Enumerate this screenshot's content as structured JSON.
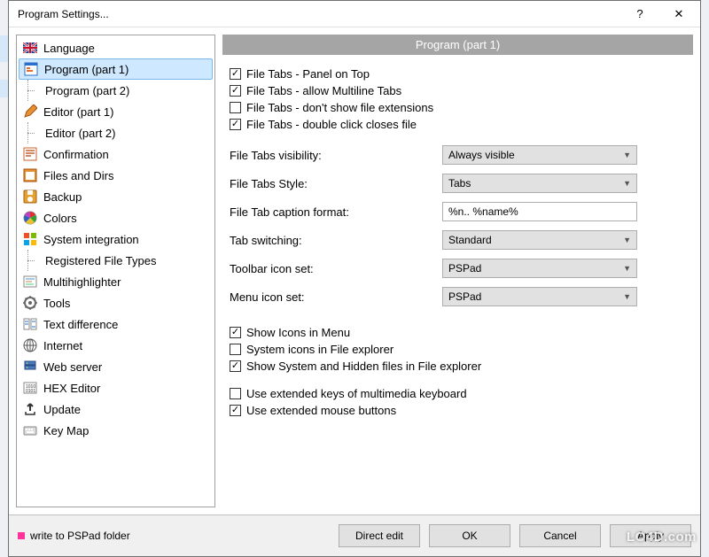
{
  "window": {
    "title": "Program Settings...",
    "help": "?",
    "close": "✕"
  },
  "sidebar": {
    "items": [
      {
        "label": "Language",
        "icon": "flag-uk-icon"
      },
      {
        "label": "Program  (part 1)",
        "icon": "program-icon",
        "selected": true
      },
      {
        "label": "Program  (part 2)",
        "icon": "none",
        "child": true
      },
      {
        "label": "Editor  (part 1)",
        "icon": "editor-icon"
      },
      {
        "label": "Editor  (part 2)",
        "icon": "none",
        "child": true
      },
      {
        "label": "Confirmation",
        "icon": "confirm-icon"
      },
      {
        "label": "Files and Dirs",
        "icon": "files-icon"
      },
      {
        "label": "Backup",
        "icon": "backup-icon"
      },
      {
        "label": "Colors",
        "icon": "colors-icon"
      },
      {
        "label": "System integration",
        "icon": "windows-icon"
      },
      {
        "label": "Registered File Types",
        "icon": "none",
        "child": true
      },
      {
        "label": "Multihighlighter",
        "icon": "highlight-icon"
      },
      {
        "label": "Tools",
        "icon": "tools-icon"
      },
      {
        "label": "Text difference",
        "icon": "diff-icon"
      },
      {
        "label": "Internet",
        "icon": "globe-icon"
      },
      {
        "label": "Web server",
        "icon": "server-icon"
      },
      {
        "label": "HEX Editor",
        "icon": "hex-icon"
      },
      {
        "label": "Update",
        "icon": "update-icon"
      },
      {
        "label": "Key Map",
        "icon": "keymap-icon"
      }
    ]
  },
  "main": {
    "heading": "Program  (part 1)",
    "cb_group1": [
      {
        "label": "File Tabs - Panel on Top",
        "checked": true
      },
      {
        "label": "File Tabs - allow Multiline Tabs",
        "checked": true
      },
      {
        "label": "File Tabs - don't show file extensions",
        "checked": false
      },
      {
        "label": "File Tabs - double click closes file",
        "checked": true
      }
    ],
    "fields": [
      {
        "label": "File Tabs visibility:",
        "type": "select",
        "value": "Always visible"
      },
      {
        "label": "File Tabs Style:",
        "type": "select",
        "value": "Tabs"
      },
      {
        "label": "File Tab caption format:",
        "type": "text",
        "value": "%n.. %name%"
      },
      {
        "label": "Tab switching:",
        "type": "select",
        "value": "Standard"
      },
      {
        "label": "Toolbar icon set:",
        "type": "select",
        "value": "PSPad"
      },
      {
        "label": "Menu icon set:",
        "type": "select",
        "value": "PSPad"
      }
    ],
    "cb_group2": [
      {
        "label": "Show Icons in Menu",
        "checked": true
      },
      {
        "label": "System icons in File explorer",
        "checked": false
      },
      {
        "label": "Show System and Hidden files in File explorer",
        "checked": true
      }
    ],
    "cb_group3": [
      {
        "label": "Use extended keys of multimedia keyboard",
        "checked": false
      },
      {
        "label": "Use extended mouse buttons",
        "checked": true
      }
    ]
  },
  "footer": {
    "status": "write to PSPad folder",
    "buttons": {
      "direct_edit": "Direct edit",
      "ok": "OK",
      "cancel": "Cancel",
      "apply": "Apply"
    }
  },
  "watermark": "LO4D.com",
  "icons": {
    "flag-uk-icon": "<svg width='16' height='12'><rect width='16' height='12' fill='#1a3c8a'/><path d='M0 0 L16 12 M16 0 L0 12' stroke='#fff' stroke-width='2.5'/><path d='M0 0 L16 12 M16 0 L0 12' stroke='#c8102e' stroke-width='1'/><rect x='6.5' width='3' height='12' fill='#fff'/><rect y='4.5' width='16' height='3' fill='#fff'/><rect x='7' width='2' height='12' fill='#c8102e'/><rect y='5' width='16' height='2' fill='#c8102e'/></svg>",
    "program-icon": "<svg width='16' height='16'><rect x='1' y='1' width='14' height='14' fill='#fff' stroke='#2a6fc9'/><rect x='1' y='1' width='14' height='3' fill='#2a6fc9'/><rect x='3' y='6' width='4' height='2' fill='#e07030'/><rect x='3' y='9' width='7' height='2' fill='#e07030'/></svg>",
    "editor-icon": "<svg width='16' height='16'><path d='M2 14 L4 8 L12 0 L16 4 L8 12 Z' fill='#e89030' stroke='#a05010'/><path d='M2 14 L1 15 L2 14' fill='#333'/></svg>",
    "confirm-icon": "<svg width='16' height='16'><rect x='1' y='1' width='14' height='14' fill='#fff' stroke='#c86030'/><path d='M3 4 h10 M3 7 h10 M3 10 h6' stroke='#c86030' stroke-width='1.5'/></svg>",
    "files-icon": "<svg width='16' height='16'><rect x='1' y='1' width='14' height='14' fill='#e89030' stroke='#a05010'/><rect x='3' y='4' width='10' height='9' fill='#fff'/></svg>",
    "backup-icon": "<svg width='16' height='16'><rect x='1' y='1' width='14' height='14' fill='#e8a030' stroke='#a06010' rx='1'/><rect x='5' y='1' width='6' height='5' fill='#fff'/><circle cx='8' cy='11' r='3' fill='#fff'/></svg>",
    "colors-icon": "<svg width='16' height='16'><circle cx='8' cy='8' r='7' fill='#fff' stroke='#888'/><path d='M8 8 L8 1 A7 7 0 0 1 14 5 Z' fill='#e03030'/><path d='M8 8 L14 5 A7 7 0 0 1 13 13 Z' fill='#30a030'/><path d='M8 8 L13 13 A7 7 0 0 1 3 13 Z' fill='#e8c030'/><path d='M8 8 L3 13 A7 7 0 0 1 2 5 Z' fill='#3060c0'/><path d='M8 8 L2 5 A7 7 0 0 1 8 1 Z' fill='#c040c0'/></svg>",
    "windows-icon": "<svg width='16' height='16'><rect x='1' y='1' width='6' height='6' fill='#f25022'/><rect x='9' y='1' width='6' height='6' fill='#7fba00'/><rect x='1' y='9' width='6' height='6' fill='#00a4ef'/><rect x='9' y='9' width='6' height='6' fill='#ffb900'/></svg>",
    "highlight-icon": "<svg width='16' height='16'><rect x='1' y='2' width='14' height='12' fill='#fff' stroke='#888'/><rect x='3' y='4' width='10' height='2' fill='#a0c8e8'/><rect x='3' y='7' width='7' height='2' fill='#e8c0a0'/><rect x='3' y='10' width='9' height='2' fill='#a0e8c0'/></svg>",
    "tools-icon": "<svg width='16' height='16'><circle cx='8' cy='8' r='6' fill='none' stroke='#666' stroke-width='2'/><circle cx='8' cy='8' r='2' fill='#666'/><path d='M8 0v3M8 13v3M0 8h3M13 8h3M2.5 2.5l2 2M11.5 11.5l2 2M2.5 13.5l2-2M11.5 4.5l2-2' stroke='#666' stroke-width='1.5'/></svg>",
    "diff-icon": "<svg width='16' height='16'><rect x='1' y='2' width='6' height='12' fill='#fff' stroke='#888'/><rect x='9' y='2' width='6' height='12' fill='#fff' stroke='#888'/><path d='M2 5h4M2 8h4M10 5h4M10 11h4' stroke='#2a6fc9'/></svg>",
    "globe-icon": "<svg width='16' height='16'><circle cx='8' cy='8' r='7' fill='#fff' stroke='#555'/><path d='M1 8h14M8 1v14' stroke='#555'/><ellipse cx='8' cy='8' rx='3.5' ry='7' fill='none' stroke='#555'/></svg>",
    "server-icon": "<svg width='16' height='16'><rect x='2' y='2' width='12' height='4' fill='#4a7ac0' stroke='#2a4a80'/><rect x='2' y='7' width='12' height='4' fill='#4a7ac0' stroke='#2a4a80'/><circle cx='4.5' cy='4' r='0.8' fill='#9f6'/><circle cx='4.5' cy='9' r='0.8' fill='#9f6'/></svg>",
    "hex-icon": "<svg width='16' height='16'><rect x='1' y='2' width='14' height='12' fill='#fff' stroke='#888'/><text x='3' y='8' font-size='5' fill='#333'>1010</text><text x='3' y='13' font-size='5' fill='#333'>0101</text></svg>",
    "update-icon": "<svg width='16' height='16'><path d='M8 2 L8 10 M8 2 L5 5 M8 2 L11 5' stroke='#333' stroke-width='2' fill='none'/><path d='M3 11 v3 h10 v-3' stroke='#333' stroke-width='1.5' fill='none'/></svg>",
    "keymap-icon": "<svg width='16' height='16'><rect x='1' y='4' width='14' height='9' fill='#ddd' stroke='#888' rx='1'/><rect x='3' y='6' width='2' height='2' fill='#fff'/><rect x='6' y='6' width='2' height='2' fill='#fff'/><rect x='9' y='6' width='2' height='2' fill='#fff'/><rect x='4' y='9' width='8' height='2' fill='#fff'/></svg>",
    "none": ""
  }
}
